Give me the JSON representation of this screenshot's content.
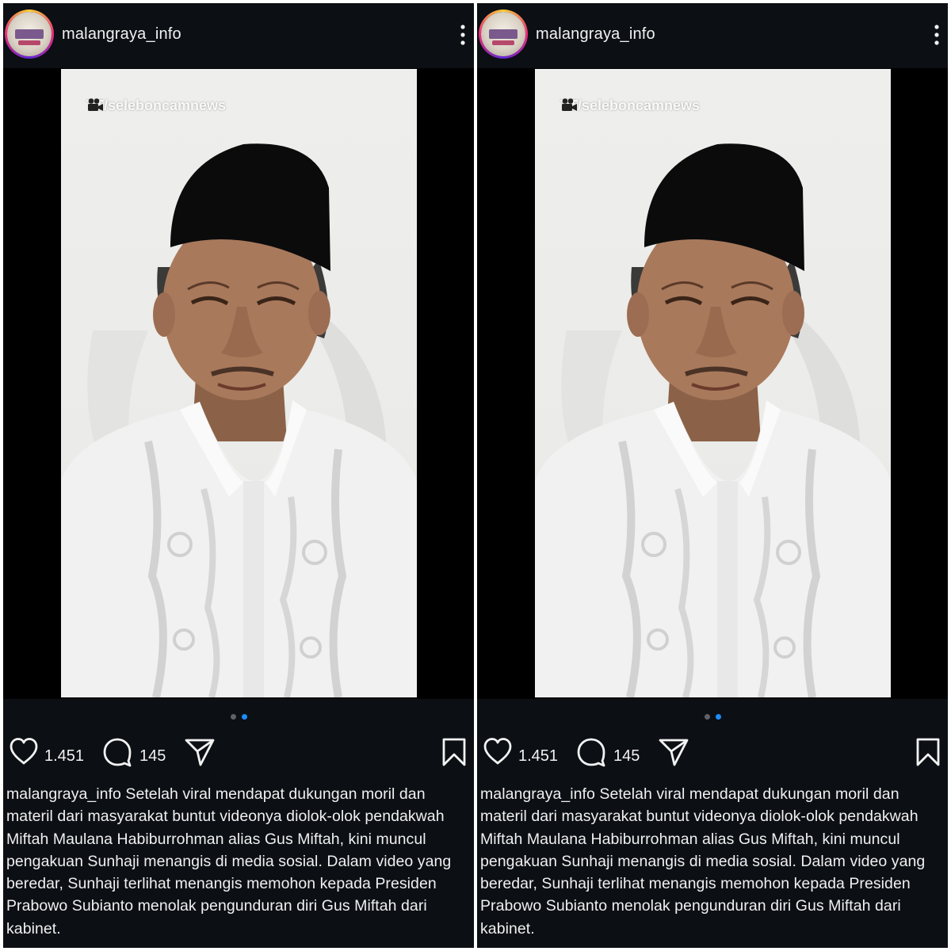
{
  "post": {
    "username": "malangraya_info",
    "watermark": "TT/seleboncamnews",
    "likes": "1.451",
    "comments": "145",
    "carousel": {
      "count": 2,
      "active_index": 1
    },
    "caption_lines": [
      "malangraya_info Setelah viral mendapat dukungan moril dan",
      "materil dari masyarakat buntut videonya diolok-olok pendakwah",
      "Miftah Maulana Habiburrohman alias Gus Miftah, kini muncul",
      "pengakuan Sunhaji menangis di media sosial. Dalam video yang",
      "beredar, Sunhaji terlihat menangis memohon kepada Presiden",
      "Prabowo Subianto menolak pengunduran diri Gus Miftah dari",
      "kabinet."
    ]
  },
  "icons": {
    "more": "more-vertical-icon",
    "like": "heart-icon",
    "comment": "comment-icon",
    "share": "send-icon",
    "save": "bookmark-icon",
    "camera": "video-camera-icon"
  },
  "colors": {
    "background": "#0c0f14",
    "text": "#f2f2f2",
    "dot_active": "#1d8cf8",
    "dot_inactive": "#5e6166",
    "story_ring": "#ee2a7b"
  }
}
